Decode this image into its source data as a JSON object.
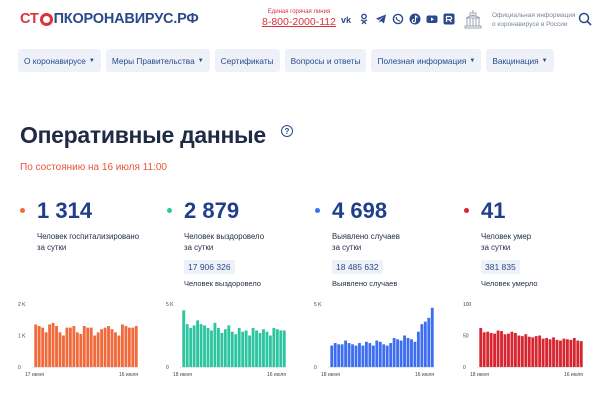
{
  "header": {
    "logo": {
      "part1": "СТ",
      "part2": "ПКОРОНАВИРУС.РФ"
    },
    "hotline_label": "Единая горячая линия",
    "hotline_number": "8-800-2000-112",
    "socials": [
      "vk-icon",
      "odnoklassniki-icon",
      "telegram-icon",
      "viber-icon",
      "tiktok-icon",
      "youtube-icon",
      "rutube-icon"
    ],
    "official_line1": "Официальная информация",
    "official_line2": "о коронавирусе в России"
  },
  "nav": [
    {
      "label": "О коронавирусе",
      "dropdown": true
    },
    {
      "label": "Меры Правительства",
      "dropdown": true
    },
    {
      "label": "Сертификаты",
      "dropdown": false
    },
    {
      "label": "Вопросы и ответы",
      "dropdown": false
    },
    {
      "label": "Полезная информация",
      "dropdown": true
    },
    {
      "label": "Вакцинация",
      "dropdown": true
    }
  ],
  "page": {
    "title": "Оперативные данные",
    "subtitle": "По состоянию на 16 июля 11:00"
  },
  "stats": [
    {
      "value": "1 314",
      "desc1": "Человек госпитализировано",
      "desc2": "за сутки",
      "total": "",
      "total_label": "",
      "color": "#f06a3b"
    },
    {
      "value": "2 879",
      "desc1": "Человек выздоровело",
      "desc2": "за сутки",
      "total": "17 906 326",
      "total_label": "Человек выздоровело",
      "color": "#2cc5a0"
    },
    {
      "value": "4 698",
      "desc1": "Выявлено случаев",
      "desc2": "за сутки",
      "total": "18 485 632",
      "total_label": "Выявлено случаев",
      "color": "#3e6ef0"
    },
    {
      "value": "41",
      "desc1": "Человек умер",
      "desc2": "за сутки",
      "total": "381 835",
      "total_label": "Человек умерло",
      "color": "#d7262f"
    }
  ],
  "chart_data": [
    {
      "type": "bar",
      "color": "#f06a3b",
      "yticks": [
        "2 K",
        "1 K",
        "0"
      ],
      "ylim": [
        0,
        2000
      ],
      "xstart": "17 июня",
      "xend": "16 июля",
      "values": [
        1350,
        1300,
        1250,
        1100,
        1350,
        1400,
        1300,
        1100,
        1000,
        1250,
        1250,
        1300,
        1100,
        1050,
        1300,
        1250,
        1250,
        1000,
        1100,
        1200,
        1250,
        1300,
        1200,
        1100,
        1000,
        1350,
        1300,
        1250,
        1250,
        1300
      ]
    },
    {
      "type": "bar",
      "color": "#2cc5a0",
      "yticks": [
        "5 K",
        "0"
      ],
      "ylim": [
        0,
        5000
      ],
      "xstart": "18 июня",
      "xend": "16 июля",
      "values": [
        4500,
        3400,
        3100,
        3300,
        3700,
        3400,
        3300,
        3100,
        2900,
        3500,
        3100,
        2700,
        3000,
        3300,
        2800,
        2600,
        3100,
        2800,
        2900,
        2500,
        3100,
        2900,
        2700,
        3000,
        2800,
        2500,
        3100,
        3000,
        2900,
        2900
      ]
    },
    {
      "type": "bar",
      "color": "#3e6ef0",
      "yticks": [
        "5 K",
        "0"
      ],
      "ylim": [
        0,
        5000
      ],
      "xstart": "18 июня",
      "xend": "16 июля",
      "values": [
        1700,
        1900,
        1800,
        1800,
        2100,
        1900,
        1800,
        1700,
        1900,
        1700,
        2000,
        1900,
        1700,
        2100,
        2000,
        1800,
        1700,
        1900,
        2300,
        2200,
        2100,
        2500,
        2300,
        2200,
        2000,
        2800,
        3400,
        3600,
        3900,
        4700
      ]
    },
    {
      "type": "bar",
      "color": "#d7262f",
      "yticks": [
        "100",
        "50",
        "0"
      ],
      "ylim": [
        0,
        100
      ],
      "xstart": "18 июня",
      "xend": "16 июля",
      "values": [
        62,
        55,
        56,
        54,
        53,
        58,
        57,
        52,
        53,
        56,
        54,
        50,
        49,
        52,
        48,
        47,
        49,
        50,
        45,
        46,
        44,
        47,
        43,
        42,
        45,
        44,
        43,
        46,
        42,
        41
      ]
    }
  ]
}
